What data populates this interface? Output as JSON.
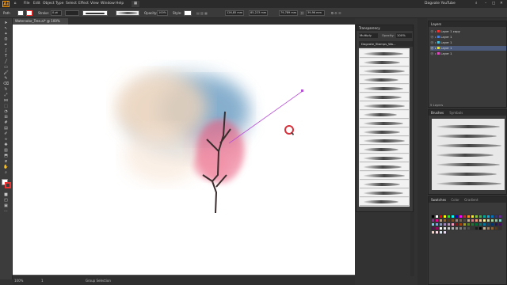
{
  "app": {
    "logo": "Ai",
    "workspace": "Dagvate YouTube"
  },
  "menu": [
    "File",
    "Edit",
    "Object",
    "Type",
    "Select",
    "Effect",
    "View",
    "Window",
    "Help"
  ],
  "control": {
    "selection": "Path",
    "stroke_label": "Stroke:",
    "stroke_value": "0 pt",
    "uniform": "Uniform",
    "opacity_label": "Opacity:",
    "opacity_value": "100%",
    "style_label": "Style:",
    "x_value": "126,85 mm",
    "y_value": "85,223 mm",
    "w_value": "79,789 mm",
    "h_value": "39,96 mm"
  },
  "document": {
    "tab_title": "Watercolor_Tree.ai* @ 100% (RGB/GPU Preview)",
    "zoom": "100%",
    "page": "1",
    "tool_status": "Group Selection"
  },
  "transparency": {
    "title": "Transparency",
    "blend_mode": "Multiply",
    "opacity_label": "Opacity:",
    "opacity_value": "100%",
    "library_name": "Dagvate_Stamps_Wa..."
  },
  "layers": {
    "title": "Layers",
    "items": [
      "Layer 1 copy",
      "Layer 1",
      "Layer 1",
      "Layer 1",
      "Layer 1"
    ],
    "footer": "5 Layers"
  },
  "brushes": {
    "tabs": [
      "Brushes",
      "Symbols"
    ]
  },
  "swatches": {
    "tabs": [
      "Swatches",
      "Color",
      "Gradient"
    ],
    "colors": [
      "#000000",
      "#ffffff",
      "#ff0000",
      "#ffff00",
      "#00ff00",
      "#00ffff",
      "#0000ff",
      "#ff00ff",
      "#ed1c24",
      "#f7941d",
      "#fff200",
      "#8dc63f",
      "#39b54a",
      "#00a99d",
      "#00aeef",
      "#0072bc",
      "#2e3192",
      "#662d91",
      "#92278f",
      "#ec008c",
      "#c69c6d",
      "#8c6239",
      "#603913",
      "#754c24",
      "#998675",
      "#736357",
      "#534741",
      "#c7b299",
      "#f26d7d",
      "#f69679",
      "#fdc689",
      "#fff799",
      "#c4df9b",
      "#a3d39c",
      "#82ca9c",
      "#7accc8",
      "#6dcff6",
      "#7da7d9",
      "#8393ca",
      "#a187be",
      "#bd8cbf",
      "#f49ac1",
      "#9e0b0f",
      "#a0410d",
      "#aba000",
      "#598527",
      "#197b30",
      "#007236",
      "#00746b",
      "#0076a3",
      "#004a80",
      "#003471",
      "#1b1464",
      "#440e62",
      "#630460",
      "#9e005d",
      "#ffffff",
      "#e6e6e6",
      "#cccccc",
      "#b3b3b3",
      "#999999",
      "#808080",
      "#666666",
      "#4d4d4d",
      "#333333",
      "#1a1a1a",
      "#000000",
      "#c2b59b",
      "#a67c52",
      "#8c6239",
      "#603913",
      "#362f2d",
      "#f9d1c1",
      "#fcdce5",
      "#d8e9f7",
      "#e3d7ea"
    ]
  },
  "colors": {
    "accent": "#ff9a00",
    "selection": "#b84fd8",
    "cursor": "#d8313c"
  }
}
